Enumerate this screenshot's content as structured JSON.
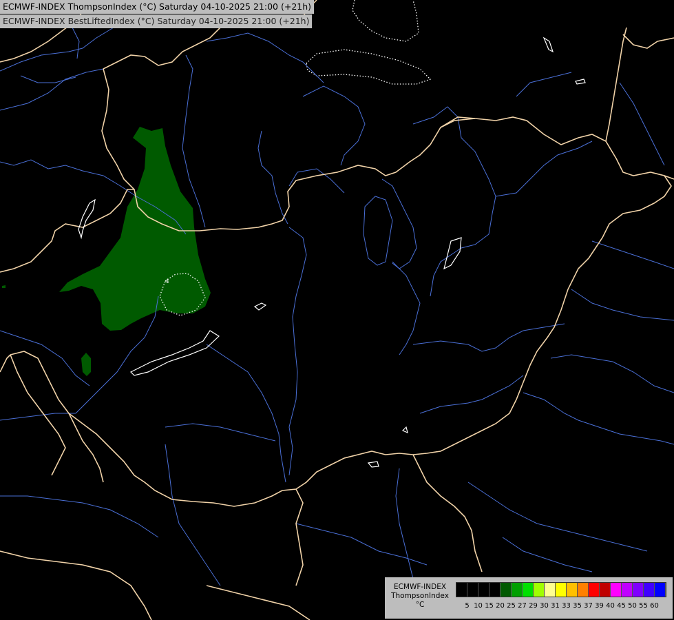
{
  "header": {
    "line1": "ECMWF-INDEX ThompsonIndex (°C) Saturday 04-10-2025 21:00 (+21h)",
    "line2": "ECMWF-INDEX BestLiftedIndex (°C) Saturday 04-10-2025 21:00 (+21h)"
  },
  "legend": {
    "model": "ECMWF-INDEX",
    "parameter": "ThompsonIndex",
    "unit": "°C",
    "colors": [
      "#000000",
      "#000000",
      "#000000",
      "#000000",
      "#005a00",
      "#00a000",
      "#00e000",
      "#a0ff00",
      "#ffff90",
      "#ffff00",
      "#ffc000",
      "#ff8000",
      "#ff0000",
      "#c00000",
      "#ff00ff",
      "#c000ff",
      "#8000ff",
      "#4000ff",
      "#0000ff"
    ],
    "ticks": [
      "5",
      "10",
      "15",
      "20",
      "25",
      "27",
      "29",
      "30",
      "31",
      "33",
      "35",
      "37",
      "39",
      "40",
      "45",
      "50",
      "55",
      "60"
    ]
  },
  "map": {
    "colors": {
      "background": "#000000",
      "border": "#f0d2a8",
      "river": "#4a6fd6",
      "coast": "#ffffff",
      "index_fill": "#005a00",
      "lifted_contour": "#ffffff"
    },
    "contour_label": "4"
  }
}
